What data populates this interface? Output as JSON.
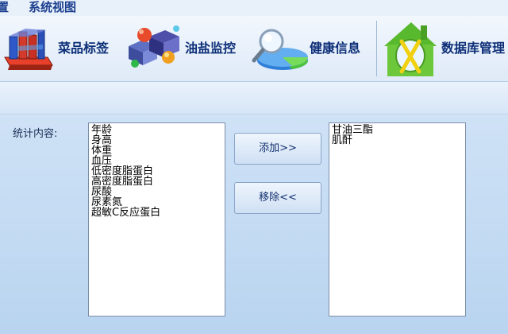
{
  "menu": {
    "items": [
      "置",
      "系统视图"
    ]
  },
  "toolbar": {
    "buttons": [
      {
        "label": "菜品标签",
        "icon": "meal-tray-icon"
      },
      {
        "label": "油盐监控",
        "icon": "cubes-icon"
      },
      {
        "label": "健康信息",
        "icon": "magnifier-chart-icon"
      },
      {
        "label": "数据库管理",
        "icon": "database-house-icon"
      }
    ]
  },
  "form": {
    "stat_label": "统计内容:",
    "available_items": [
      "年龄",
      "身高",
      "体重",
      "血压",
      "低密度脂蛋白",
      "高密度脂蛋白",
      "尿酸",
      "尿素氮",
      "超敏C反应蛋白"
    ],
    "selected_items": [
      "甘油三酯",
      "肌酐"
    ],
    "add_button": "添加>>",
    "remove_button": "移除<<"
  }
}
